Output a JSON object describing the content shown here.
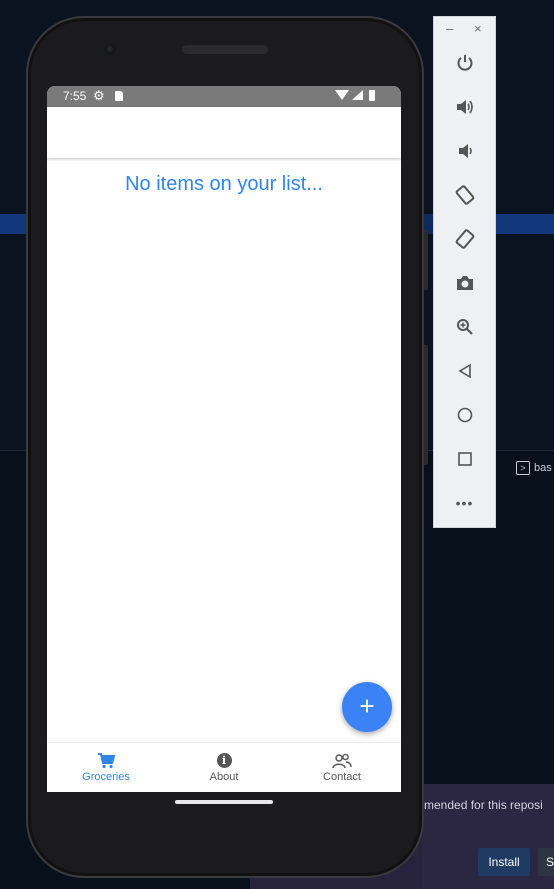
{
  "background": {
    "terminal_tab_label": "bas",
    "notification_text": "mended for this reposi",
    "install_button_label": "Install",
    "second_button_label": "S"
  },
  "statusbar": {
    "time": "7:55"
  },
  "main": {
    "empty_message": "No items on your list..."
  },
  "fab": {
    "label": "+"
  },
  "bottom_nav": {
    "items": [
      {
        "label": "Groceries",
        "icon": "cart-icon",
        "active": true
      },
      {
        "label": "About",
        "icon": "info-icon",
        "active": false
      },
      {
        "label": "Contact",
        "icon": "people-icon",
        "active": false
      }
    ]
  },
  "emulator_toolbar": {
    "minimize": "–",
    "close": "×",
    "more": "•••",
    "buttons": [
      "power-icon",
      "volume-up-icon",
      "volume-down-icon",
      "rotate-left-icon",
      "rotate-right-icon",
      "camera-icon",
      "zoom-icon",
      "back-icon",
      "home-icon",
      "overview-icon",
      "more-icon"
    ]
  },
  "colors": {
    "accent": "#2f86e8",
    "fab": "#3b82f6",
    "statusbar": "#7a7a7a"
  }
}
